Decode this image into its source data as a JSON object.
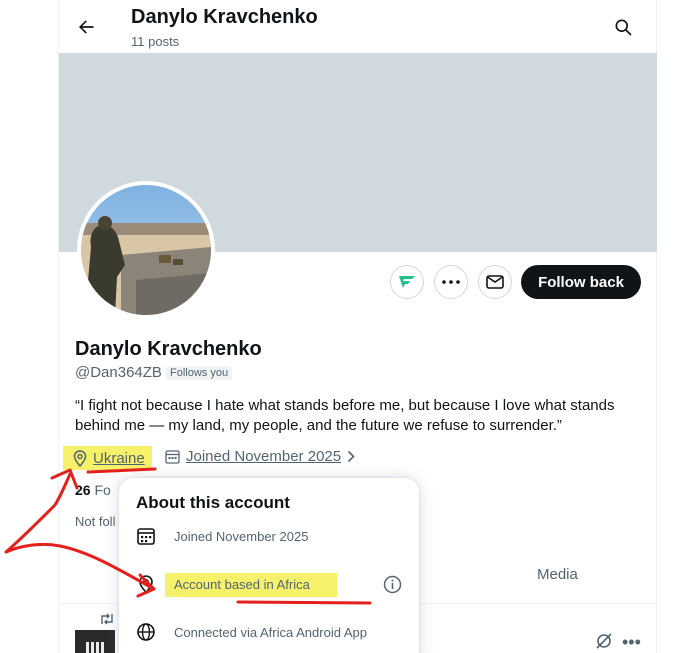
{
  "header": {
    "title": "Danylo Kravchenko",
    "post_count": "11 posts"
  },
  "profile": {
    "display_name": "Danylo Kravchenko",
    "handle": "@Dan364ZB",
    "follows_you_badge": "Follows you",
    "bio": "“I fight not because I hate what stands before me, but because I love what stands behind me — my land, my people, and the future we refuse to surrender.”",
    "location": "Ukraine",
    "joined": "Joined November 2025",
    "following_count_partial": "26",
    "followers_label_partial": "Fo",
    "not_followed_partial": "Not foll"
  },
  "actions": {
    "follow_back": "Follow back"
  },
  "tabs": {
    "media": "Media"
  },
  "popup": {
    "title": "About this account",
    "joined": "Joined November 2025",
    "based_in": "Account based in Africa",
    "connected_via": "Connected via Africa Android App"
  },
  "colors": {
    "highlight": "#f6f16a",
    "annotation": "#e3201b",
    "banner": "#cfd9de",
    "primary_button": "#0f1419"
  }
}
